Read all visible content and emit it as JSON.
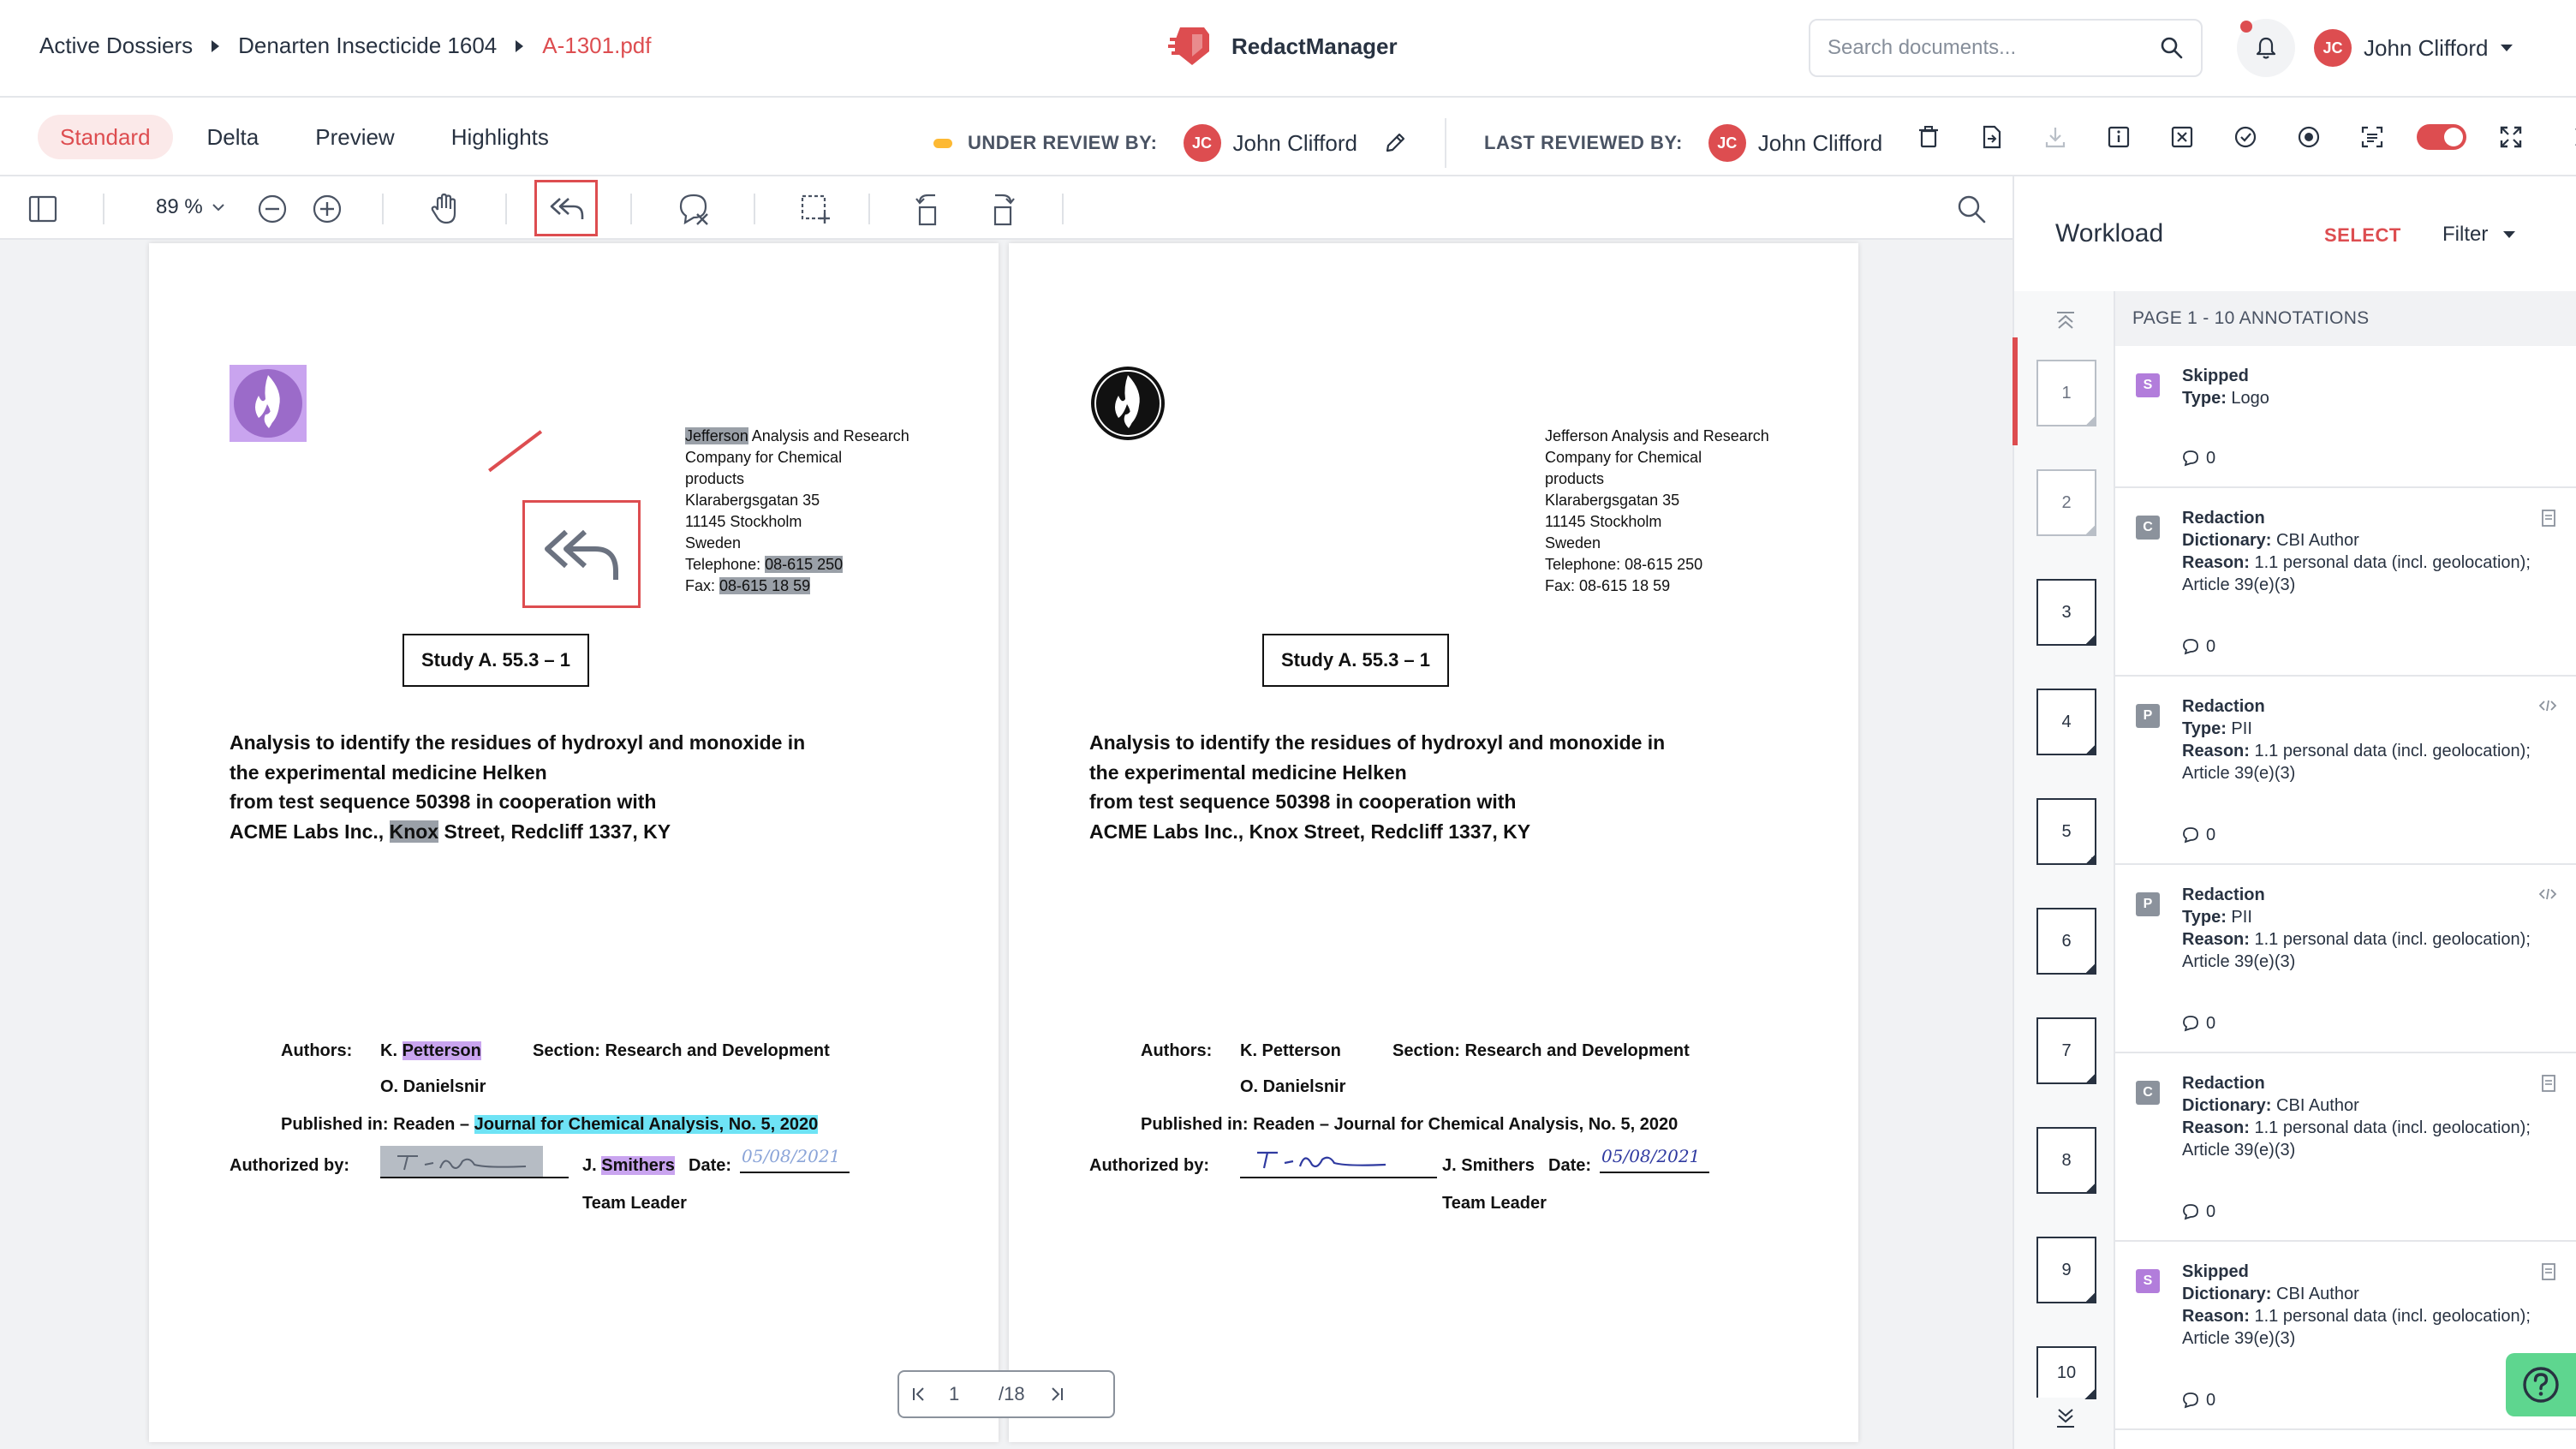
{
  "breadcrumb": {
    "items": [
      "Active Dossiers",
      "Denarten Insecticide 1604"
    ],
    "current": "A-1301.pdf"
  },
  "brand": {
    "name": "RedactManager",
    "color": "#dd4d50"
  },
  "search": {
    "placeholder": "Search documents..."
  },
  "user": {
    "initials": "JC",
    "name": "John Clifford"
  },
  "modes": [
    "Standard",
    "Delta",
    "Preview",
    "Highlights"
  ],
  "active_mode": "Standard",
  "review": {
    "under_review_label": "UNDER REVIEW BY:",
    "under_review_initials": "JC",
    "under_review_name": "John Clifford",
    "last_reviewed_label": "LAST REVIEWED BY:",
    "last_reviewed_initials": "JC",
    "last_reviewed_name": "John Clifford"
  },
  "viewer_toolbar": {
    "zoom": "89 %"
  },
  "document": {
    "address": {
      "line1_highlight": "Jefferson",
      "line1_rest": " Analysis and Research",
      "line1_full": "Jefferson Analysis and Research",
      "line2": "Company for Chemical",
      "line3": "products",
      "line4": "Klarabergsgatan 35",
      "line5": "11145 Stockholm",
      "line6": "Sweden",
      "tel_label": "Telephone: ",
      "tel_value": "08-615 250",
      "fax_label": "Fax: ",
      "fax_value": "08-615 18 59"
    },
    "study": "Study A. 55.3 – 1",
    "title": {
      "line1": "Analysis to identify the residues of hydroxyl and monoxide in",
      "line2": "the experimental medicine Helken",
      "line3": "from test sequence 50398 in cooperation with",
      "line4_a": "ACME Labs Inc., ",
      "line4_hl": "Knox",
      "line4_b": " Street, Redcliff 1337, KY"
    },
    "authors_label": "Authors:",
    "author1": "K. Petterson",
    "author2": "O. Danielsnir",
    "section": "Section: Research and Development",
    "published_label": "Published in: Readen – ",
    "published_journal": "Journal for Chemical Analysis, No. 5, 2020",
    "authorized_label": "Authorized by:",
    "signer": "J. Smithers",
    "date_label": "Date:",
    "date_value": "05/08/2021",
    "role": "Team Leader"
  },
  "pager": {
    "current": "1",
    "total": "/18"
  },
  "workload": {
    "title": "Workload",
    "select_label": "SELECT",
    "filter_label": "Filter",
    "page_header": "PAGE 1 - 10 ANNOTATIONS",
    "thumbs": [
      "1",
      "2",
      "3",
      "4",
      "5",
      "6",
      "7",
      "8",
      "9",
      "10"
    ],
    "annotations": [
      {
        "badge": "S",
        "badge_color": "#b27ddb",
        "title": "Skipped",
        "k1": "Type:",
        "v1": "Logo",
        "comments": "0"
      },
      {
        "badge": "C",
        "badge_color": "#8b929c",
        "title": "Redaction",
        "k1": "Dictionary:",
        "v1": "CBI Author",
        "k2": "Reason:",
        "v2": "1.1 personal data (incl. geolocation); Article 39(e)(3)",
        "comments": "0"
      },
      {
        "badge": "P",
        "badge_color": "#8b929c",
        "title": "Redaction",
        "k1": "Type:",
        "v1": "PII",
        "k2": "Reason:",
        "v2": "1.1 personal data (incl. geolocation); Article 39(e)(3)",
        "comments": "0"
      },
      {
        "badge": "P",
        "badge_color": "#8b929c",
        "title": "Redaction",
        "k1": "Type:",
        "v1": "PII",
        "k2": "Reason:",
        "v2": "1.1 personal data (incl. geolocation); Article 39(e)(3)",
        "comments": "0"
      },
      {
        "badge": "C",
        "badge_color": "#8b929c",
        "title": "Redaction",
        "k1": "Dictionary:",
        "v1": "CBI Author",
        "k2": "Reason:",
        "v2": "1.1 personal data (incl. geolocation); Article 39(e)(3)",
        "comments": "0"
      },
      {
        "badge": "S",
        "badge_color": "#b27ddb",
        "title": "Skipped",
        "k1": "Dictionary:",
        "v1": "CBI Author",
        "k2": "Reason:",
        "v2": "1.1 personal data (incl. geolocation); Article 39(e)(3)",
        "comments": "0"
      }
    ]
  },
  "icons": {
    "toolbar": [
      "sidebar-toggle-icon",
      "zoom-out-icon",
      "zoom-in-icon",
      "pan-hand-icon",
      "reply-all-icon",
      "comment-clear-icon",
      "area-select-icon",
      "rotate-left-icon",
      "rotate-right-icon",
      "search-icon"
    ],
    "actions": [
      "delete-icon",
      "export-icon",
      "download-icon",
      "info-icon",
      "excel-icon",
      "approve-icon",
      "record-icon",
      "ocr-icon",
      "fullscreen-icon",
      "close-icon"
    ]
  },
  "colors": {
    "accent": "#dd4d50",
    "skipped": "#b27ddb",
    "redaction": "#8b929c",
    "under_review": "#fdb933",
    "help": "#5ed68f"
  }
}
